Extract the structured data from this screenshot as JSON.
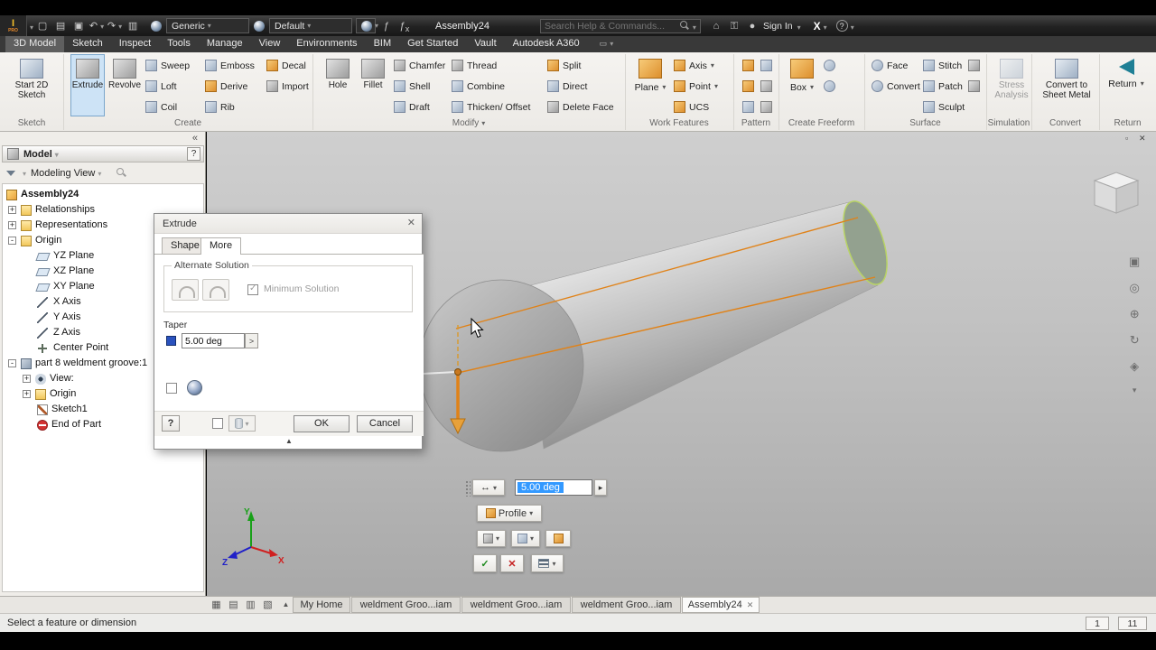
{
  "title_bar": {
    "logo_main": "I",
    "logo_sub": "PRO",
    "material_value": "Generic",
    "appearance_value": "Default",
    "document_title": "Assembly24",
    "search_placeholder": "Search Help & Commands...",
    "sign_in_label": "Sign In",
    "exchange_label": "X"
  },
  "ribbon_tabs": [
    "3D Model",
    "Sketch",
    "Inspect",
    "Tools",
    "Manage",
    "View",
    "Environments",
    "BIM",
    "Get Started",
    "Vault",
    "Autodesk A360"
  ],
  "ribbon": {
    "sketch": {
      "start_2d_sketch": "Start 2D Sketch",
      "panel_label": "Sketch"
    },
    "create": {
      "extrude": "Extrude",
      "revolve": "Revolve",
      "sweep": "Sweep",
      "loft": "Loft",
      "coil": "Coil",
      "emboss": "Emboss",
      "derive": "Derive",
      "rib": "Rib",
      "decal": "Decal",
      "import": "Import",
      "panel_label": "Create"
    },
    "modify": {
      "hole": "Hole",
      "fillet": "Fillet",
      "chamfer": "Chamfer",
      "shell": "Shell",
      "draft": "Draft",
      "thread": "Thread",
      "combine": "Combine",
      "thicken_offset": "Thicken/ Offset",
      "split": "Split",
      "direct": "Direct",
      "delete_face": "Delete Face",
      "panel_label": "Modify"
    },
    "work_features": {
      "plane": "Plane",
      "axis": "Axis",
      "point": "Point",
      "ucs": "UCS",
      "panel_label": "Work Features"
    },
    "pattern": {
      "panel_label": "Pattern"
    },
    "freeform": {
      "box": "Box",
      "panel_label": "Create Freeform"
    },
    "surface": {
      "face": "Face",
      "convert": "Convert",
      "stitch": "Stitch",
      "patch": "Patch",
      "sculpt": "Sculpt",
      "panel_label": "Surface"
    },
    "simulation": {
      "stress_analysis": "Stress Analysis",
      "panel_label": "Simulation"
    },
    "convert": {
      "sheet_metal": "Convert to Sheet Metal",
      "panel_label": "Convert"
    },
    "return": {
      "return_label": "Return",
      "panel_label": "Return"
    }
  },
  "browser": {
    "header": "Model",
    "view_filter": "Modeling View",
    "tree": [
      {
        "label": "Assembly24"
      },
      {
        "label": "Relationships",
        "expand": "+"
      },
      {
        "label": "Representations",
        "expand": "+"
      },
      {
        "label": "Origin",
        "expand": "-"
      },
      {
        "label": "YZ Plane"
      },
      {
        "label": "XZ Plane"
      },
      {
        "label": "XY Plane"
      },
      {
        "label": "X Axis"
      },
      {
        "label": "Y Axis"
      },
      {
        "label": "Z Axis"
      },
      {
        "label": "Center Point"
      },
      {
        "label": "part 8 weldment groove:1",
        "expand": "-"
      },
      {
        "label": "View:",
        "expand": "+"
      },
      {
        "label": "Origin",
        "expand": "+"
      },
      {
        "label": "Sketch1"
      },
      {
        "label": "End of Part"
      }
    ]
  },
  "dialog": {
    "title": "Extrude",
    "tab_shape": "Shape",
    "tab_more": "More",
    "alternate_solution_label": "Alternate Solution",
    "minimum_solution_label": "Minimum Solution",
    "taper_label": "Taper",
    "taper_value": "5.00 deg",
    "ok_label": "OK",
    "cancel_label": "Cancel"
  },
  "mini_toolbar": {
    "taper_value": "5.00 deg",
    "profile_label": "Profile"
  },
  "viewport": {
    "triad": {
      "x": "X",
      "y": "Y",
      "z": "Z"
    }
  },
  "doc_tabs": [
    "My Home",
    "weldment Groo...iam",
    "weldment Groo...iam",
    "weldment Groo...iam",
    "Assembly24"
  ],
  "status_bar": {
    "message": "Select a feature or dimension",
    "value_left": "1",
    "value_right": "11"
  },
  "colors": {
    "selection_blue": "#3399ff",
    "taper_orange": "#e08218",
    "check_green": "#1f8a1f",
    "cancel_red": "#c52222"
  }
}
